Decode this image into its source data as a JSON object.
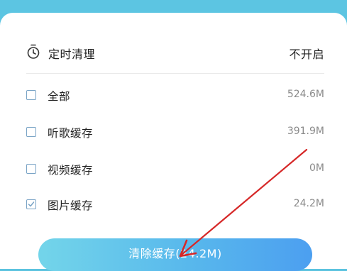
{
  "timer": {
    "label": "定时清理",
    "value": "不开启"
  },
  "options": [
    {
      "label": "全部",
      "size": "524.6M",
      "checked": false
    },
    {
      "label": "听歌缓存",
      "size": "391.9M",
      "checked": false
    },
    {
      "label": "视频缓存",
      "size": "0M",
      "checked": false
    },
    {
      "label": "图片缓存",
      "size": "24.2M",
      "checked": true
    }
  ],
  "clear_button": {
    "label": "清除缓存(24.2M)"
  },
  "colors": {
    "accent_top": "#5cc5e2",
    "button_start": "#73d5ea",
    "button_end": "#4c9ff0",
    "annotation_arrow": "#d62828",
    "checkbox_border": "#7aa4c6"
  }
}
